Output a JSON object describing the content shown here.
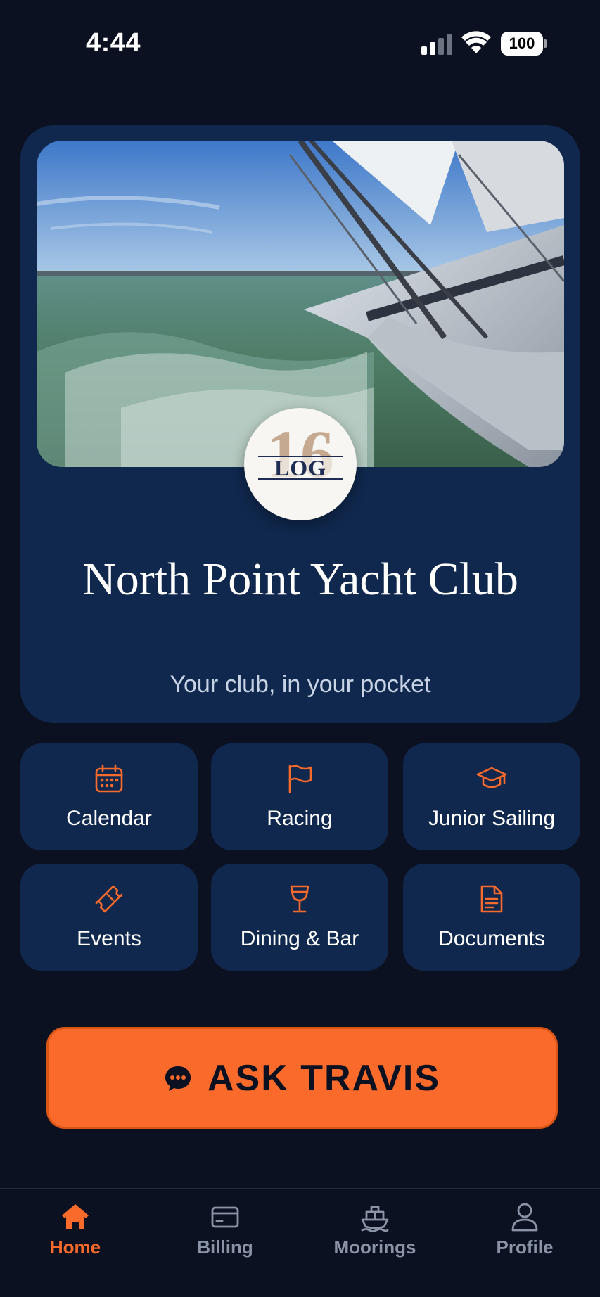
{
  "status_bar": {
    "time": "4:44",
    "battery": "100"
  },
  "hero": {
    "image_description_icon": "sailboat-photo",
    "logo": {
      "number": "16",
      "text": "LOG"
    },
    "club_name": "North Point Yacht Club",
    "tagline": "Your club, in your pocket"
  },
  "tiles": [
    {
      "label": "Calendar",
      "icon": "calendar-icon"
    },
    {
      "label": "Racing",
      "icon": "flag-icon"
    },
    {
      "label": "Junior Sailing",
      "icon": "graduation-cap-icon"
    },
    {
      "label": "Events",
      "icon": "ticket-icon"
    },
    {
      "label": "Dining & Bar",
      "icon": "wine-glass-icon"
    },
    {
      "label": "Documents",
      "icon": "document-icon"
    }
  ],
  "cta": {
    "label": "ASK TRAVIS",
    "icon": "chat-bubble-icon"
  },
  "tab_bar": {
    "tabs": [
      {
        "label": "Home",
        "icon": "home-icon",
        "active": true
      },
      {
        "label": "Billing",
        "icon": "credit-card-icon",
        "active": false
      },
      {
        "label": "Moorings",
        "icon": "boat-icon",
        "active": false
      },
      {
        "label": "Profile",
        "icon": "person-icon",
        "active": false
      }
    ]
  },
  "colors": {
    "background": "#0b1121",
    "card": "#10284d",
    "accent": "#f96a2b",
    "muted": "#8a94a6"
  }
}
